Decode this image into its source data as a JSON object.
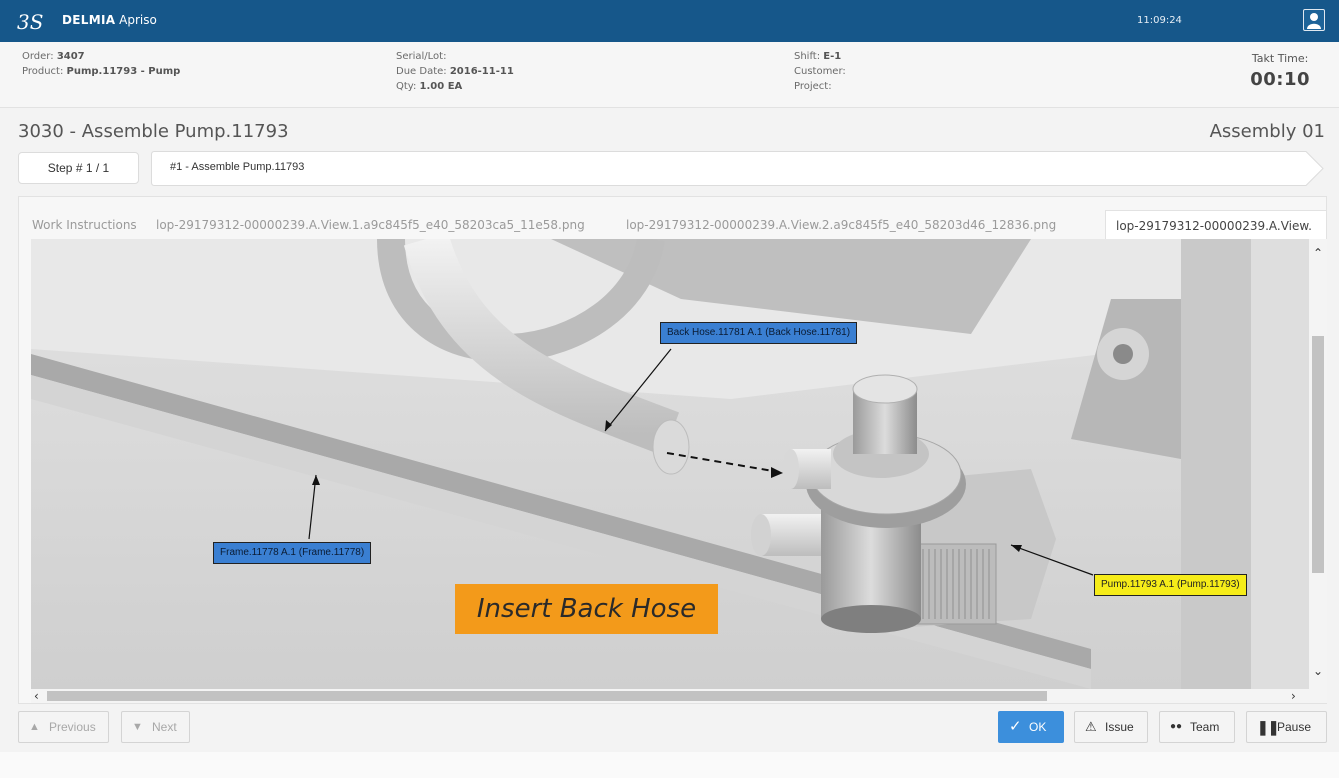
{
  "topbar": {
    "brand_bold": "DELMIA",
    "brand_rest": " Apriso",
    "clock": "11:09:24"
  },
  "info": {
    "order_label": "Order:",
    "order_value": "3407",
    "product_label": "Product:",
    "product_value": "Pump.11793 - Pump",
    "serial_label": "Serial/Lot:",
    "due_label": "Due Date:",
    "due_value": "2016-11-11",
    "qty_label": "Qty:",
    "qty_value": "1.00 EA",
    "shift_label": "Shift:",
    "shift_value": "E-1",
    "customer_label": "Customer:",
    "project_label": "Project:",
    "takt_label": "Takt Time:",
    "takt_value": "00:10"
  },
  "operation": {
    "title": "3030 - Assemble Pump.11793",
    "station": "Assembly 01"
  },
  "step": {
    "counter": "Step # 1 / 1",
    "name": "#1 - Assemble Pump.11793"
  },
  "tabs": [
    {
      "label": "Work Instructions"
    },
    {
      "label": "lop-29179312-00000239.A.View.1.a9c845f5_e40_58203ca5_11e58.png"
    },
    {
      "label": "lop-29179312-00000239.A.View.2.a9c845f5_e40_58203d46_12836.png"
    },
    {
      "label": "lop-29179312-00000239.A.View."
    }
  ],
  "viewer": {
    "callouts": {
      "back_hose": "Back Hose.11781 A.1 (Back Hose.11781)",
      "frame": "Frame.11778 A.1 (Frame.11778)",
      "pump": "Pump.11793 A.1 (Pump.11793)"
    },
    "banner": "Insert Back Hose"
  },
  "buttons": {
    "previous": "Previous",
    "next": "Next",
    "ok": "OK",
    "issue": "Issue",
    "team": "Team",
    "pause": "Pause"
  },
  "colors": {
    "topbar": "#16578a",
    "ok_button": "#3c8fdc",
    "callout_blue": "#3a7fd2",
    "callout_yellow": "#f6ec19",
    "banner_orange": "#f39a1a"
  }
}
